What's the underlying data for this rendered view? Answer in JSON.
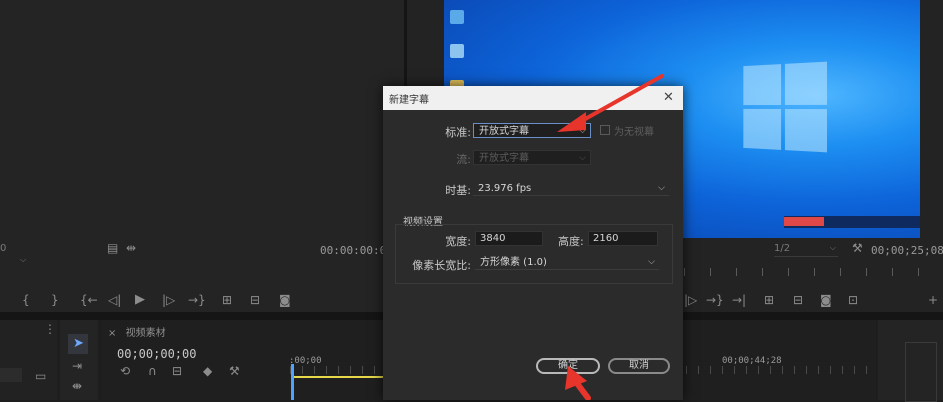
{
  "source_monitor": {
    "timecode": "00:00:00:00",
    "zoom_prefix": "0"
  },
  "program_monitor": {
    "timecode": "00;00;25;08",
    "zoom_value": "1/2"
  },
  "timeline": {
    "tab_title": "视频素材",
    "current_timecode": "00;00;00;00",
    "ruler_start": ":00;00",
    "ruler_mid": "00;00;44;28"
  },
  "dialog": {
    "title": "新建字幕",
    "standard_label": "标准:",
    "standard_value": "开放式字幕",
    "stream_checkbox_label": "为无视幕",
    "stream_label": "流:",
    "stream_value": "开放式字幕",
    "timebase_label": "时基:",
    "timebase_value": "23.976 fps",
    "video_settings_label": "视频设置",
    "width_label": "宽度:",
    "width_value": "3840",
    "height_label": "高度:",
    "height_value": "2160",
    "pixel_aspect_label": "像素长宽比:",
    "pixel_aspect_value": "方形像素 (1.0)",
    "ok_label": "确定",
    "cancel_label": "取消"
  },
  "colors": {
    "annotation_arrow": "#e8352b",
    "program_video_blue": "#0d63d8",
    "dialog_bg": "#2b2b2b",
    "playhead": "#4aa3ff",
    "work_area": "#e6d84a"
  }
}
